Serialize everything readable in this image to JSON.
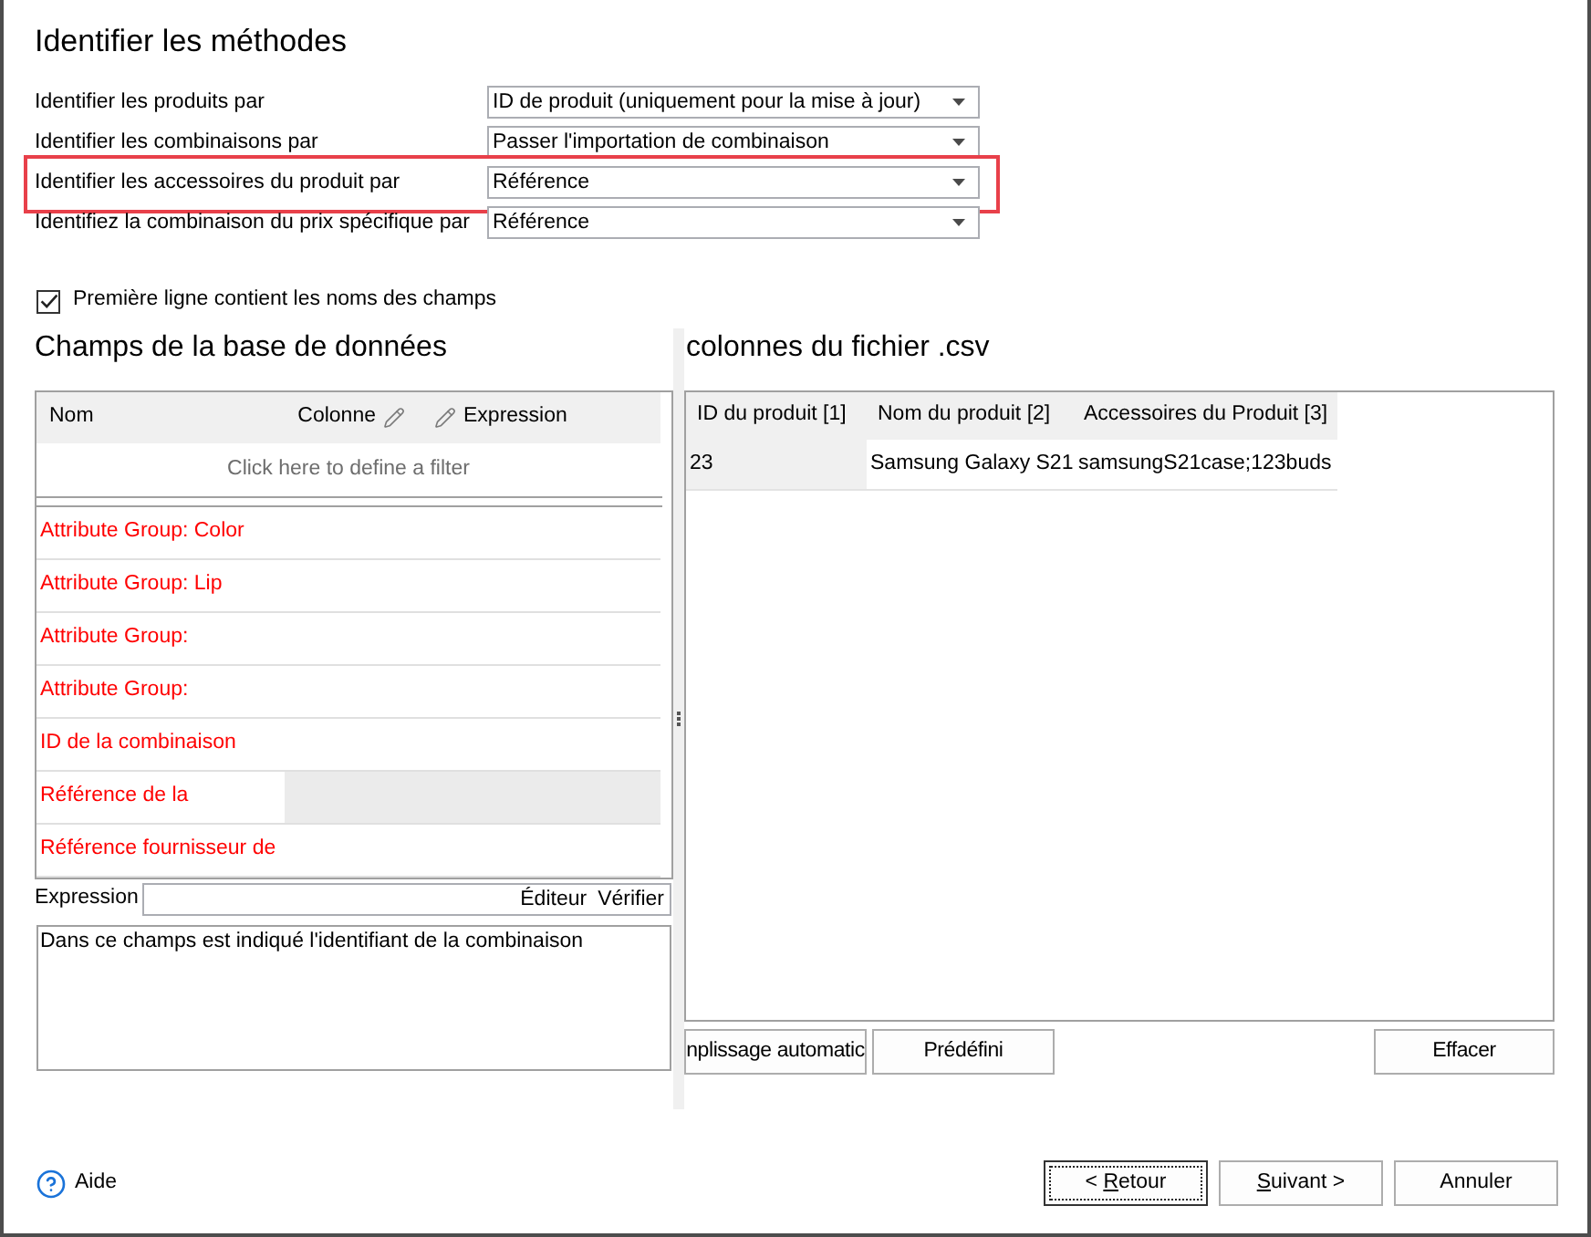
{
  "window": {
    "title": "Identifier les méthodes"
  },
  "methods": [
    {
      "label": "Identifier les produits par",
      "value": "ID de produit (uniquement pour la mise à jour)",
      "highlighted": false
    },
    {
      "label": "Identifier les combinaisons par",
      "value": "Passer l'importation de combinaison",
      "highlighted": false
    },
    {
      "label": "Identifier les accessoires du produit par",
      "value": "Référence",
      "highlighted": true
    },
    {
      "label": "Identifiez la combinaison du prix spécifique par",
      "value": "Référence",
      "highlighted": false
    }
  ],
  "first_row_option": {
    "label": "Première ligne contient les noms des champs",
    "checked": true
  },
  "database_fields": {
    "title": "Champs de la base de données",
    "columns": [
      {
        "label": "Nom",
        "kind": "plain"
      },
      {
        "label": "Colonne",
        "kind": "trailing"
      },
      {
        "label": "Expression",
        "kind": "leading"
      }
    ],
    "filter_hint": "Click here to define a filter",
    "rows": [
      {
        "name": "Attribute Group: Color",
        "selected": false
      },
      {
        "name": "Attribute Group: Lip",
        "selected": false
      },
      {
        "name": "Attribute Group:",
        "selected": false
      },
      {
        "name": "Attribute Group:",
        "selected": false
      },
      {
        "name": "ID de la combinaison",
        "selected": false
      },
      {
        "name": "Référence de la",
        "selected": true
      },
      {
        "name": "Référence fournisseur de",
        "selected": false
      }
    ],
    "expression": {
      "label": "Expression",
      "buttons": [
        "Éditeur",
        "Vérifier"
      ]
    },
    "description": "Dans ce champs est indiqué l'identifiant de la combinaison"
  },
  "csv_columns": {
    "title": "colonnes du fichier .csv",
    "columns": [
      "ID du produit [1]",
      "Nom du produit [2]",
      "Accessoires du Produit [3]"
    ],
    "rows": [
      [
        "23",
        "Samsung Galaxy S21",
        "samsungS21case;123buds"
      ]
    ],
    "buttons": [
      "nplissage automatic",
      "Prédéfini",
      "Effacer"
    ]
  },
  "footer": {
    "help": "Aide",
    "buttons": [
      {
        "text": "< ",
        "access_key": "R",
        "text_after": "etour",
        "focused": true
      },
      {
        "access_key": "S",
        "text_after": "uivant >",
        "focused": false
      },
      {
        "text": "Annuler",
        "focused": false
      }
    ]
  }
}
